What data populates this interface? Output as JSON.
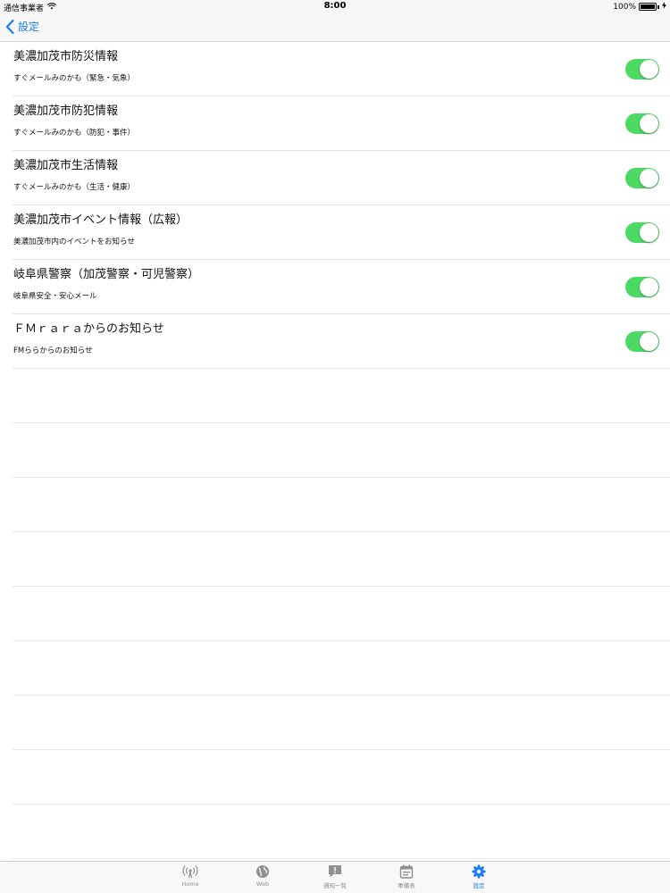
{
  "status_bar": {
    "carrier": "通信事業者",
    "time": "8:00",
    "battery": "100%",
    "battery_level": 1.0
  },
  "nav": {
    "back_label": "設定"
  },
  "settings": [
    {
      "title": "美濃加茂市防災情報",
      "subtitle": "すぐメールみのかも（緊急・気象）",
      "enabled": true
    },
    {
      "title": "美濃加茂市防犯情報",
      "subtitle": "すぐメールみのかも（防犯・事件）",
      "enabled": true
    },
    {
      "title": "美濃加茂市生活情報",
      "subtitle": "すぐメールみのかも（生活・健康）",
      "enabled": true
    },
    {
      "title": "美濃加茂市イベント情報（広報）",
      "subtitle": "美濃加茂市内のイベントをお知らせ",
      "enabled": true
    },
    {
      "title": "岐阜県警察（加茂警察・可児警察）",
      "subtitle": "岐阜県安全・安心メール",
      "enabled": true
    },
    {
      "title": "ＦＭｒａｒａからのお知らせ",
      "subtitle": "FMららからのお知らせ",
      "enabled": true
    }
  ],
  "tab_bar": {
    "tabs": [
      {
        "label": "Home",
        "icon": "broadcast-icon",
        "active": false
      },
      {
        "label": "Web",
        "icon": "globe-icon",
        "active": false
      },
      {
        "label": "通知一覧",
        "icon": "notice-icon",
        "active": false
      },
      {
        "label": "軍備表",
        "icon": "calendar-icon",
        "active": false
      },
      {
        "label": "設定",
        "icon": "gear-icon",
        "active": true
      }
    ]
  },
  "colors": {
    "accent": "#1a7cf3",
    "toggle_on": "#4cd964",
    "tab_inactive": "#8e8e93"
  }
}
